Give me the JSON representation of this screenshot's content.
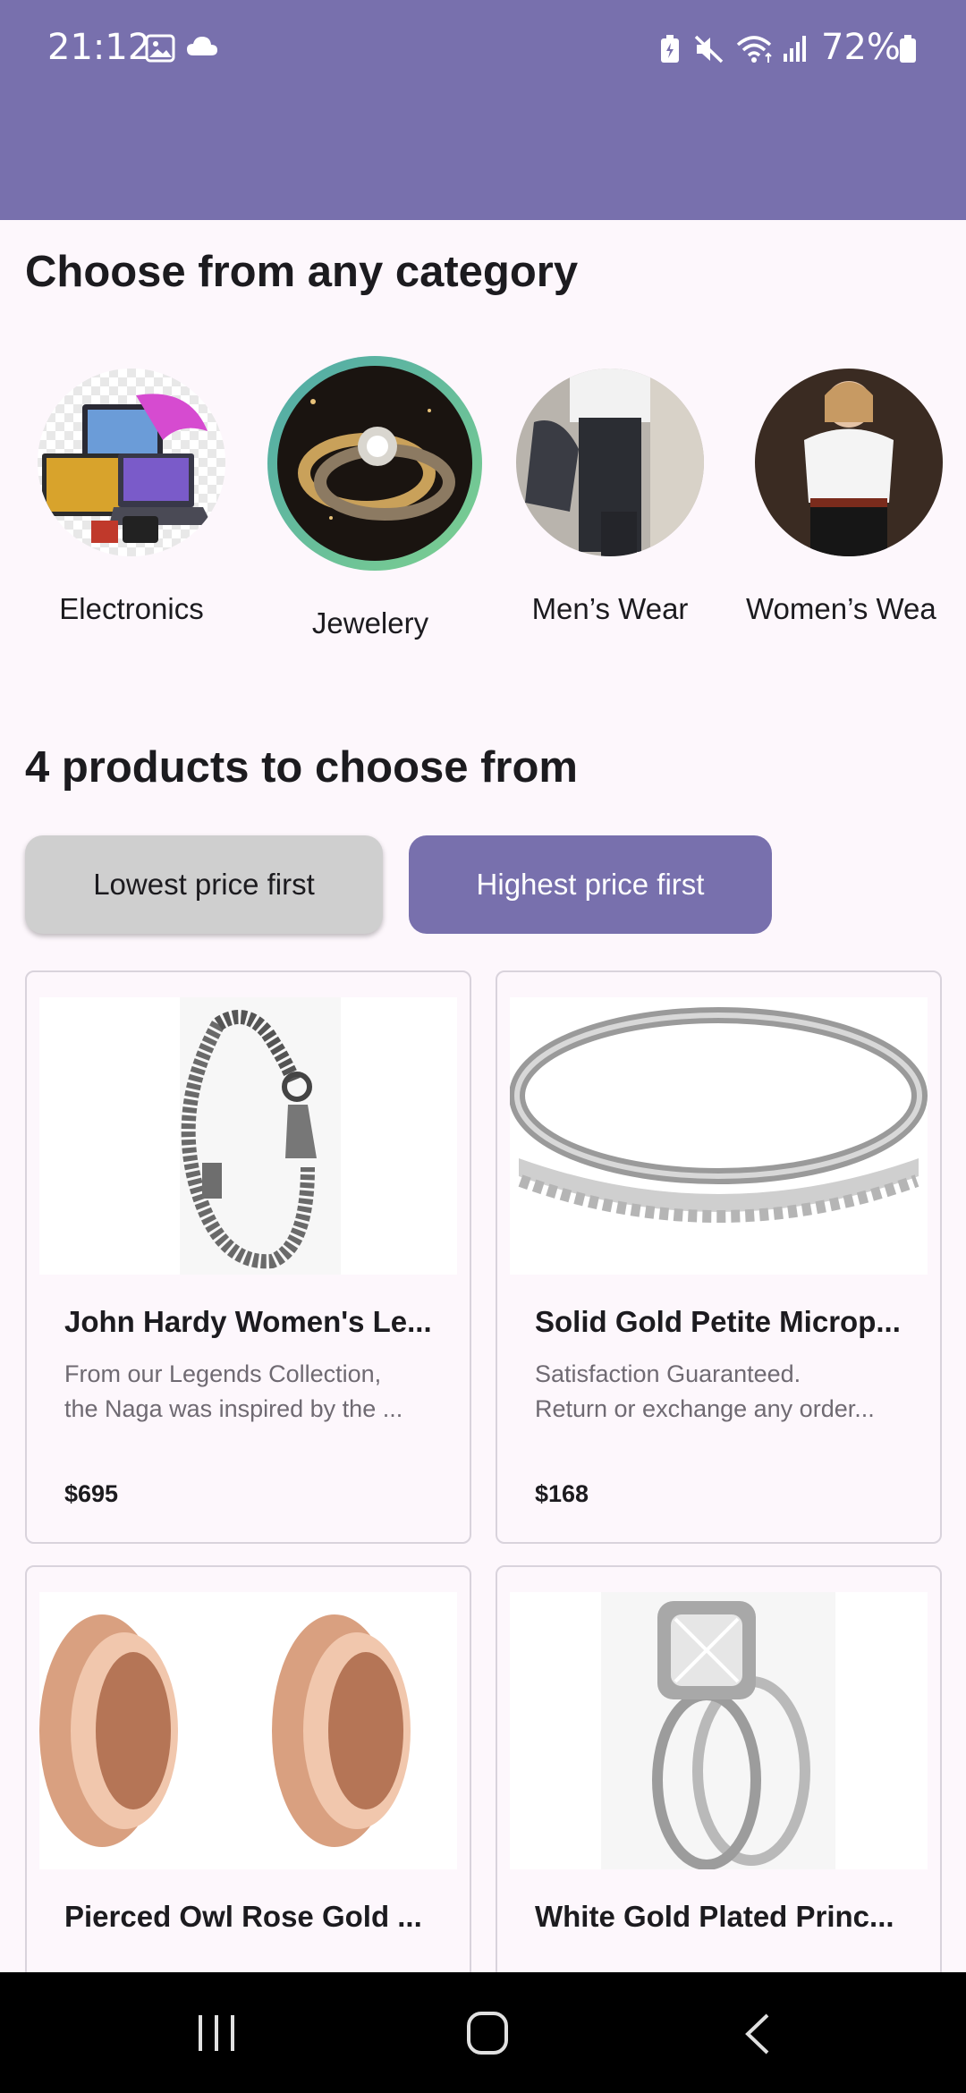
{
  "status_bar": {
    "time": "21:12",
    "battery": "72%"
  },
  "headings": {
    "categories": "Choose from any category",
    "products": "4 products to choose from"
  },
  "categories": [
    {
      "label": "Electronics",
      "selected": false
    },
    {
      "label": "Jewelery",
      "selected": true
    },
    {
      "label": "Men’s Wear",
      "selected": false
    },
    {
      "label": "Women’s Wea",
      "selected": false
    }
  ],
  "sort": {
    "low_label": "Lowest price first",
    "high_label": "Highest price first",
    "active": "high"
  },
  "products": [
    {
      "title": "John Hardy Women's Le...",
      "desc1": "From our Legends Collection,",
      "desc2": "the Naga was inspired by the ...",
      "price": "$695"
    },
    {
      "title": "Solid Gold Petite Microp...",
      "desc1": "Satisfaction Guaranteed.",
      "desc2": "Return or exchange any order...",
      "price": "$168"
    },
    {
      "title": "Pierced Owl Rose Gold ...",
      "desc1": "",
      "desc2": "",
      "price": ""
    },
    {
      "title": "White Gold Plated Princ...",
      "desc1": "",
      "desc2": "",
      "price": ""
    }
  ],
  "colors": {
    "primary": "#7870ad",
    "background": "#fdf7fc",
    "selected_ring": "#6bbf9a",
    "inactive_button": "#cfcfcf"
  }
}
